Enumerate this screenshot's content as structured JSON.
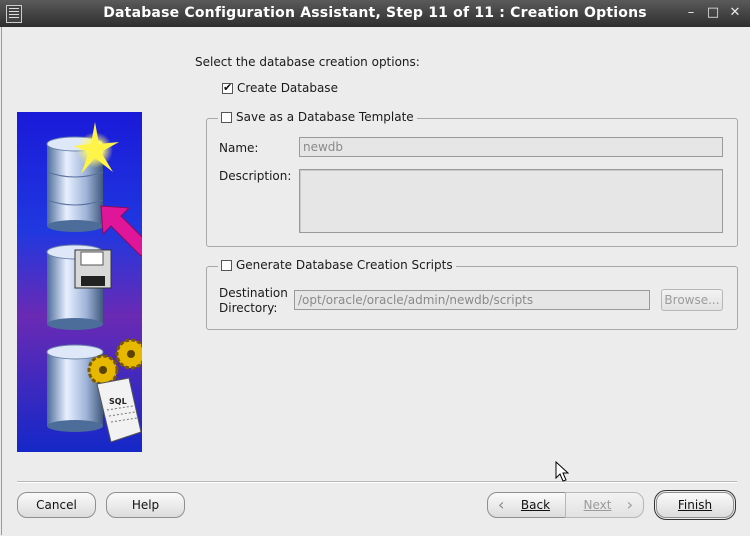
{
  "window": {
    "title": "Database Configuration Assistant, Step 11 of 11 : Creation Options",
    "controls": {
      "minimize": "–",
      "maximize": "□",
      "close": "✕"
    }
  },
  "main": {
    "instruction": "Select the database creation options:",
    "create_database": {
      "label": "Create Database",
      "checked": true
    },
    "template_group": {
      "label": "Save as a Database Template",
      "checked": false,
      "name_label": "Name:",
      "name_value": "newdb",
      "description_label": "Description:",
      "description_value": ""
    },
    "scripts_group": {
      "label": "Generate Database Creation Scripts",
      "checked": false,
      "dest_label_line1": "Destination",
      "dest_label_line2": "Directory:",
      "dest_value": "/opt/oracle/oracle/admin/newdb/scripts",
      "browse_label": "Browse..."
    },
    "art_text": "SQL"
  },
  "footer": {
    "cancel": "Cancel",
    "help": "Help",
    "back": "Back",
    "next": "Next",
    "finish": "Finish",
    "back_arrow": "‹",
    "next_arrow": "›"
  },
  "colors": {
    "titlebar": "#3c3c3c",
    "background": "#ececec",
    "art_blue": "#1020c8",
    "art_purple": "#7a2aa8",
    "arrow_magenta": "#e0169a"
  }
}
